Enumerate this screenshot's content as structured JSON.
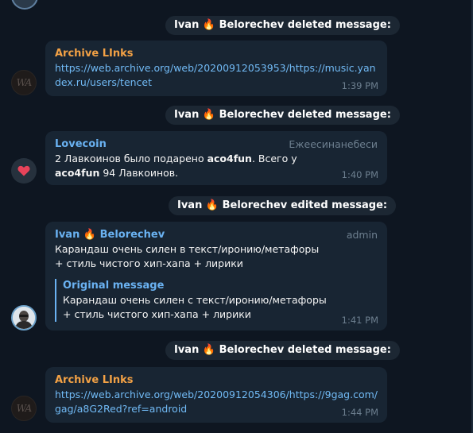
{
  "service_messages": [
    {
      "name_part1": "Ivan ",
      "flame": "🔥",
      "name_part2": " Belorechev",
      "action": " deleted message:"
    },
    {
      "name_part1": "Ivan ",
      "flame": "🔥",
      "name_part2": " Belorechev",
      "action": " deleted message:"
    },
    {
      "name_part1": "Ivan ",
      "flame": "🔥",
      "name_part2": " Belorechev",
      "action": " edited message:"
    },
    {
      "name_part1": "Ivan ",
      "flame": "🔥",
      "name_part2": " Belorechev",
      "action": " deleted message:"
    }
  ],
  "messages": [
    {
      "sender": "Archive LInks",
      "text": "https://web.archive.org/web/20200912053953/https://music.yandex.ru/users/tencet",
      "time": "1:39 PM",
      "avatar_text": "WA"
    },
    {
      "sender": "Lovecoin",
      "role": "Ежеесинанебеси",
      "text_part1": "2 Лавкоинов было подарено ",
      "bold1": "aco4fun",
      "text_part2": ". Всего у ",
      "bold2": "aco4fun",
      "text_part3": " 94 Лавкоинов.",
      "time": "1:40 PM",
      "avatar_icon": "heart-icon"
    },
    {
      "sender_part1": "Ivan ",
      "sender_flame": "🔥",
      "sender_part2": " Belorechev",
      "role": "admin",
      "text": "Карандаш очень силен в текст/иронию/метафоры + стиль чистого хип-хапа + лирики",
      "quote_title": "Original message",
      "quote_text": "Карандаш очень силен с текст/иронию/метафоры + стиль чистого хип-хапа + лирики",
      "time": "1:41 PM"
    },
    {
      "sender": "Archive LInks",
      "text": "https://web.archive.org/web/20200912054306/https://9gag.com/gag/a8G2Red?ref=android",
      "time": "1:44 PM",
      "avatar_text": "WA"
    }
  ],
  "colors": {
    "background": "#0e1621",
    "bubble": "#182533",
    "service_pill": "#1c2733",
    "link": "#71baf5",
    "sender_orange": "#f2a145",
    "sender_blue": "#6ab2f2",
    "muted": "#6d7f8f"
  }
}
